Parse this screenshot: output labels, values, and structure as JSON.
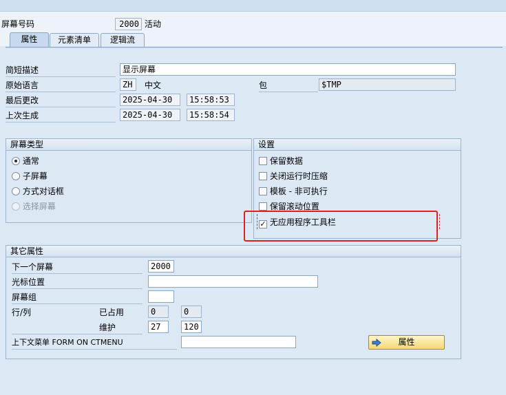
{
  "header": {
    "screen_number_label": "屏幕号码",
    "screen_number": "2000",
    "status": "活动"
  },
  "tabs": [
    {
      "label": "属性",
      "active": true
    },
    {
      "label": "元素清单",
      "active": false
    },
    {
      "label": "逻辑流",
      "active": false
    }
  ],
  "attributes": {
    "short_desc_label": "简短描述",
    "short_desc": "显示屏幕",
    "orig_lang_label": "原始语言",
    "orig_lang_code": "ZH",
    "orig_lang_name": "中文",
    "package_label": "包",
    "package": "$TMP",
    "last_changed_label": "最后更改",
    "last_changed_date": "2025-04-30",
    "last_changed_time": "15:58:53",
    "last_generated_label": "上次生成",
    "last_generated_date": "2025-04-30",
    "last_generated_time": "15:58:54"
  },
  "screen_type": {
    "title": "屏幕类型",
    "options": [
      {
        "label": "通常",
        "selected": true,
        "enabled": true
      },
      {
        "label": "子屏幕",
        "selected": false,
        "enabled": true
      },
      {
        "label": "方式对话框",
        "selected": false,
        "enabled": true
      },
      {
        "label": "选择屏幕",
        "selected": false,
        "enabled": false
      }
    ]
  },
  "settings": {
    "title": "设置",
    "options": [
      {
        "label": "保留数据",
        "checked": false
      },
      {
        "label": "关闭运行时压缩",
        "checked": false
      },
      {
        "label": "模板 - 非可执行",
        "checked": false
      },
      {
        "label": "保留滚动位置",
        "checked": false
      },
      {
        "label": "无应用程序工具栏",
        "checked": true
      }
    ]
  },
  "other": {
    "title": "其它属性",
    "next_screen_label": "下一个屏幕",
    "next_screen": "2000",
    "cursor_pos_label": "光标位置",
    "cursor_pos": "",
    "screen_group_label": "屏幕组",
    "screen_group": "",
    "row_col_label": "行/列",
    "occupied_label": "已占用",
    "occupied_row": "0",
    "occupied_col": "0",
    "maintain_label": "维护",
    "maintain_row": "27",
    "maintain_col": "120",
    "context_menu_label": "上下文菜单 FORM ON CTMENU",
    "context_menu": "",
    "attributes_button": "属性",
    "attributes_button_icon": "arrow-right-icon"
  },
  "colors": {
    "highlight_box": "#e02020",
    "background": "#dce8f4",
    "button": "#f5d774"
  }
}
